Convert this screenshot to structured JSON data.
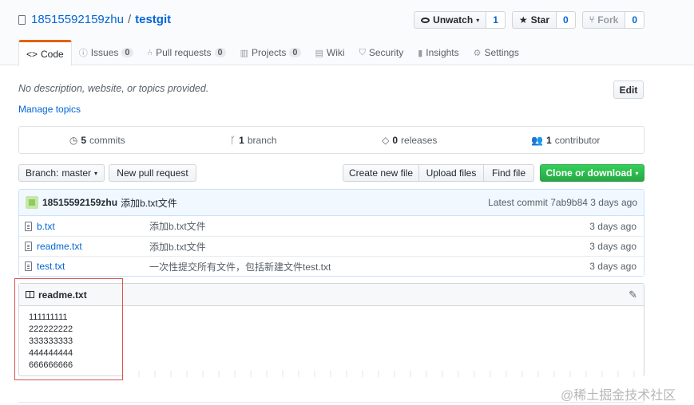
{
  "repo": {
    "owner": "18515592159zhu",
    "separator": "/",
    "name": "testgit"
  },
  "actions": {
    "watch": {
      "label": "Unwatch",
      "count": "1"
    },
    "star": {
      "label": "Star",
      "count": "0"
    },
    "fork": {
      "label": "Fork",
      "count": "0"
    }
  },
  "tabs": [
    {
      "label": "Code",
      "icon": "code-icon"
    },
    {
      "label": "Issues",
      "count": "0",
      "icon": "issue-icon"
    },
    {
      "label": "Pull requests",
      "count": "0",
      "icon": "pull-request-icon"
    },
    {
      "label": "Projects",
      "count": "0",
      "icon": "project-icon"
    },
    {
      "label": "Wiki",
      "icon": "book-icon"
    },
    {
      "label": "Security",
      "icon": "shield-icon"
    },
    {
      "label": "Insights",
      "icon": "graph-icon"
    },
    {
      "label": "Settings",
      "icon": "gear-icon"
    }
  ],
  "description": "No description, website, or topics provided.",
  "manage_topics": "Manage topics",
  "edit_label": "Edit",
  "summary": {
    "commits": {
      "num": "5",
      "label": "commits"
    },
    "branches": {
      "num": "1",
      "label": "branch"
    },
    "releases": {
      "num": "0",
      "label": "releases"
    },
    "contributors": {
      "num": "1",
      "label": "contributor"
    }
  },
  "filenav": {
    "branch_label": "Branch:",
    "branch_name": "master",
    "new_pr": "New pull request",
    "create_file": "Create new file",
    "upload_files": "Upload files",
    "find_file": "Find file",
    "clone": "Clone or download"
  },
  "tease": {
    "author": "18515592159zhu",
    "message": "添加b.txt文件",
    "latest_label": "Latest commit",
    "sha": "7ab9b84",
    "age": "3 days ago"
  },
  "files": [
    {
      "name": "b.txt",
      "message": "添加b.txt文件",
      "age": "3 days ago"
    },
    {
      "name": "readme.txt",
      "message": "添加b.txt文件",
      "age": "3 days ago"
    },
    {
      "name": "test.txt",
      "message": "一次性提交所有文件，包括新建文件test.txt",
      "age": "3 days ago"
    }
  ],
  "readme": {
    "title": "readme.txt",
    "lines": [
      "111111111",
      "222222222",
      "333333333",
      "444444444",
      "666666666"
    ]
  },
  "watermark": "@稀土掘金技术社区",
  "colors": {
    "accent_tab": "#e36209",
    "link": "#0366d6",
    "clone_green": "#28a745",
    "highlight_red": "#d9534f"
  }
}
